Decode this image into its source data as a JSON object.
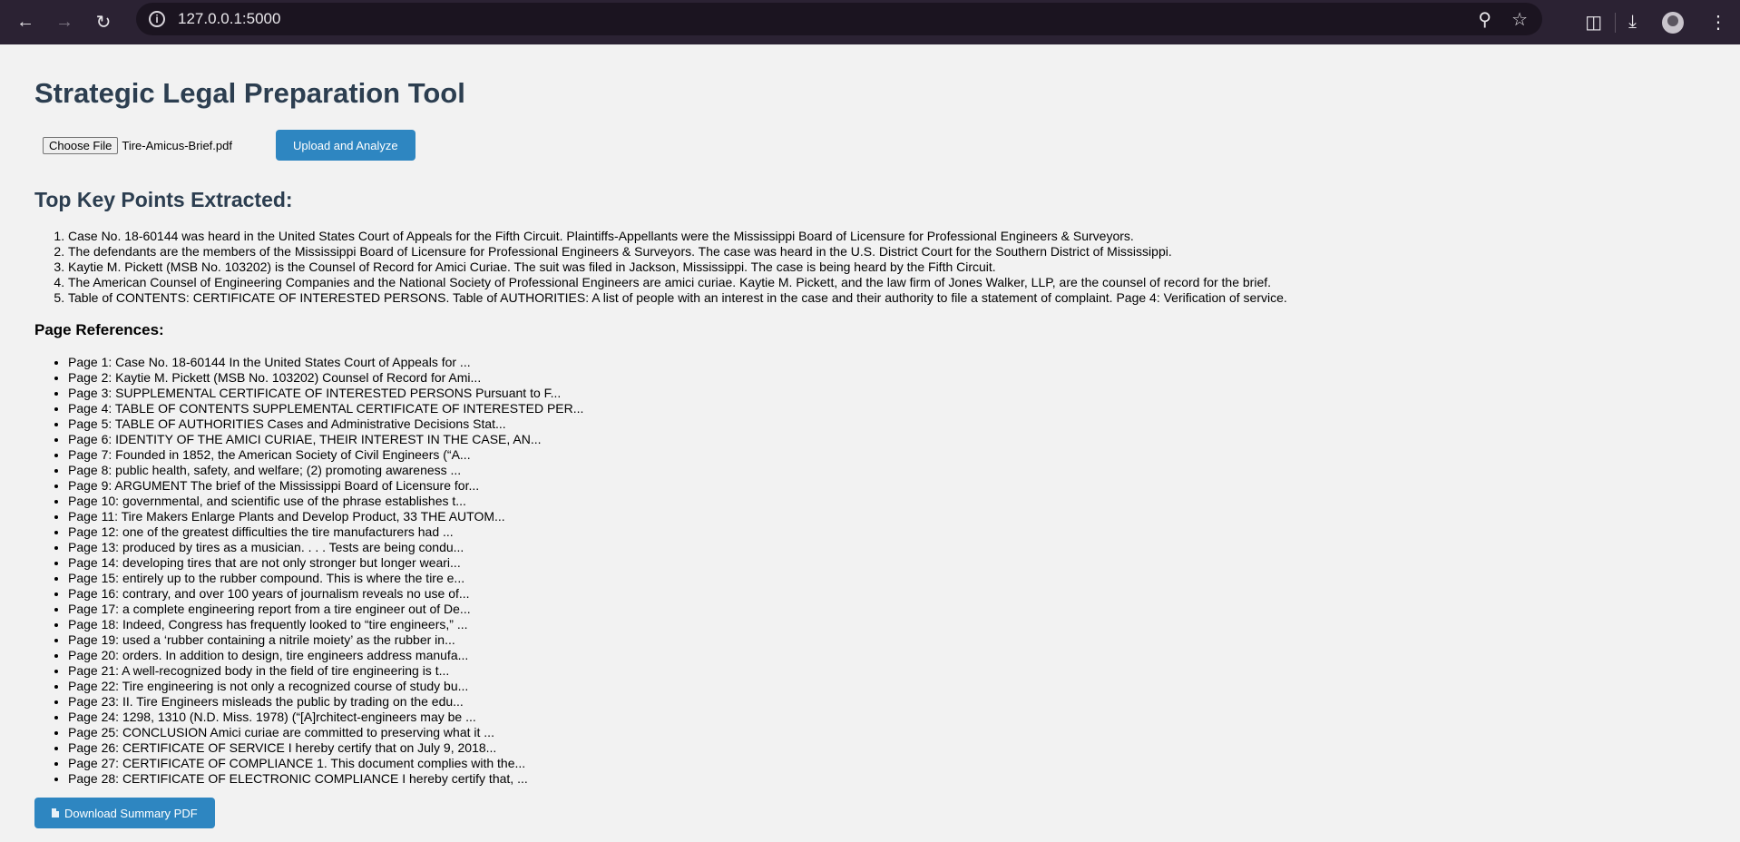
{
  "browser": {
    "url": "127.0.0.1:5000",
    "icons": [
      "back-arrow-icon",
      "forward-arrow-icon",
      "reload-icon",
      "site-info-icon",
      "zoom-icon",
      "bookmark-star-icon",
      "extensions-icon",
      "download-icon",
      "profile-avatar",
      "menu-kebab-icon"
    ]
  },
  "page": {
    "title": "Strategic Legal Preparation Tool",
    "file_button_label": "Choose File",
    "file_name": "Tire-Amicus-Brief.pdf",
    "upload_button_label": "Upload and Analyze",
    "key_points_heading": "Top Key Points Extracted:",
    "key_points": [
      "Case No. 18-60144 was heard in the United States Court of Appeals for the Fifth Circuit. Plaintiffs-Appellants were the Mississippi Board of Licensure for Professional Engineers & Surveyors.",
      "The defendants are the members of the Mississippi Board of Licensure for Professional Engineers & Surveyors. The case was heard in the U.S. District Court for the Southern District of Mississippi.",
      "Kaytie M. Pickett (MSB No. 103202) is the Counsel of Record for Amici Curiae. The suit was filed in Jackson, Mississippi. The case is being heard by the Fifth Circuit.",
      "The American Counsel of Engineering Companies and the National Society of Professional Engineers are amici curiae. Kaytie M. Pickett, and the law firm of Jones Walker, LLP, are the counsel of record for the brief.",
      "Table of CONTENTS: CERTIFICATE OF INTERESTED PERSONS. Table of AUTHORITIES: A list of people with an interest in the case and their authority to file a statement of complaint. Page 4: Verification of service."
    ],
    "page_refs_heading": "Page References:",
    "page_refs": [
      "Page 1: Case No. 18-60144 In the United States Court of Appeals for ...",
      "Page 2: Kaytie M. Pickett (MSB No. 103202) Counsel of Record for Ami...",
      "Page 3: SUPPLEMENTAL CERTIFICATE OF INTERESTED PERSONS Pursuant to F...",
      "Page 4: TABLE OF CONTENTS SUPPLEMENTAL CERTIFICATE OF INTERESTED PER...",
      "Page 5: TABLE OF AUTHORITIES Cases and Administrative Decisions Stat...",
      "Page 6: IDENTITY OF THE AMICI CURIAE, THEIR INTEREST IN THE CASE, AN...",
      "Page 7: Founded in 1852, the American Society of Civil Engineers (“A...",
      "Page 8: public health, safety, and welfare; (2) promoting awareness ...",
      "Page 9: ARGUMENT The brief of the Mississippi Board of Licensure for...",
      "Page 10: governmental, and scientific use of the phrase establishes t...",
      "Page 11: Tire Makers Enlarge Plants and Develop Product, 33 THE AUTOM...",
      "Page 12: one of the greatest difficulties the tire manufacturers had ...",
      "Page 13: produced by tires as a musician. . . . Tests are being condu...",
      "Page 14: developing tires that are not only stronger but longer weari...",
      "Page 15: entirely up to the rubber compound. This is where the tire e...",
      "Page 16: contrary, and over 100 years of journalism reveals no use of...",
      "Page 17: a complete engineering report from a tire engineer out of De...",
      "Page 18: Indeed, Congress has frequently looked to “tire engineers,” ...",
      "Page 19: used a ‘rubber containing a nitrile moiety’ as the rubber in...",
      "Page 20: orders. In addition to design, tire engineers address manufa...",
      "Page 21: A well-recognized body in the field of tire engineering is t...",
      "Page 22: Tire engineering is not only a recognized course of study bu...",
      "Page 23: II. Tire Engineers misleads the public by trading on the edu...",
      "Page 24: 1298, 1310 (N.D. Miss. 1978) (“[A]rchitect-engineers may be ...",
      "Page 25: CONCLUSION Amici curiae are committed to preserving what it ...",
      "Page 26: CERTIFICATE OF SERVICE I hereby certify that on July 9, 2018...",
      "Page 27: CERTIFICATE OF COMPLIANCE 1. This document complies with the...",
      "Page 28: CERTIFICATE OF ELECTRONIC COMPLIANCE I hereby certify that, ..."
    ],
    "download_button_label": "Download Summary PDF"
  },
  "colors": {
    "accent": "#2e86c1",
    "heading": "#2c3e50",
    "background": "#f2f2f2",
    "chrome": "#2b2233"
  }
}
